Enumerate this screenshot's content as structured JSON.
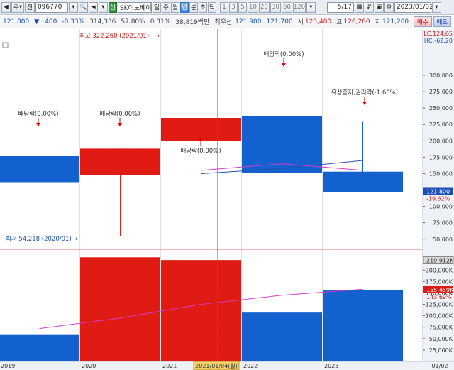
{
  "toolbar": {
    "mode": "주",
    "search_label": "전",
    "code": "096770",
    "name": "SK이노베이",
    "period_buttons": [
      "일",
      "주",
      "월",
      "년",
      "분",
      "초",
      "틱"
    ],
    "selected_period": "년",
    "interval_buttons": [
      "1",
      "3",
      "5",
      "10",
      "20",
      "30",
      "60",
      "120"
    ],
    "page": "5/17",
    "date": "2023/01/02"
  },
  "quote": {
    "price": "121,800",
    "change": "400",
    "change_pct": "-0.33%",
    "volume": "314,336",
    "volume_ratio": "57.80%",
    "turnover_ratio": "0.31%",
    "amount": "38,819백만",
    "best_label": "최우선",
    "ask": "121,900",
    "bid": "121,700",
    "open_label": "시",
    "open": "123,400",
    "high_label": "고",
    "high": "126,200",
    "low_label": "저",
    "low": "121,200",
    "buy_button": "매수",
    "sell_button": "매도"
  },
  "colors": {
    "up": "#e01b14",
    "down": "#1360cf",
    "ma": "#d23cc8"
  },
  "chart_data": {
    "type": "candlestick",
    "categories": [
      "2019",
      "2020",
      "2021",
      "2022",
      "2023"
    ],
    "candles": [
      {
        "open": 137000,
        "high": 177000,
        "low": 139000,
        "close": 177000,
        "down": true
      },
      {
        "open": 148000,
        "high": 188000,
        "low": 54218,
        "close": 188000,
        "down": false
      },
      {
        "open": 200000,
        "high": 322260,
        "low": 139000,
        "close": 235000,
        "down": false
      },
      {
        "open": 238000,
        "high": 275000,
        "low": 139000,
        "close": 151000,
        "down": true
      },
      {
        "open": 153000,
        "high": 229000,
        "low": 121200,
        "close": 121800,
        "down": true
      }
    ],
    "ma_upper": [
      null,
      null,
      150000,
      158000,
      170000
    ],
    "ma_lower": [
      null,
      null,
      155000,
      165000,
      155000
    ],
    "price_ylim": [
      40000,
      300000
    ],
    "price_ticks": [
      "300,000",
      "275,000",
      "250,000",
      "225,000",
      "200,000",
      "175,000",
      "150,000",
      "125,000",
      "100,000",
      "75,000",
      "50,000"
    ],
    "price_ticks_values": [
      300000,
      275000,
      250000,
      225000,
      200000,
      175000,
      150000,
      125000,
      100000,
      75000,
      50000
    ],
    "price_label": "121,800",
    "price_label_pct": "-19.62%",
    "lc_label": "LC:124.65",
    "hc_label": "HC:-62.20",
    "annotations": {
      "high": "최고 322,260 (2021/01)",
      "low": "최저 54,218 (2020/01)",
      "dividends": [
        "배당락(0.00%)",
        "배당락(0.00%)",
        "배당락(0.00%)",
        "배당락(0.00%)"
      ],
      "rights": "유상증자,권리락(-1.60%)"
    },
    "volume": {
      "values": [
        58000,
        228000,
        222000,
        107000,
        155459
      ],
      "ylim": [
        0,
        230000
      ],
      "ticks": [
        "200,000K",
        "175,000K",
        "150,000K",
        "125,000K",
        "100,000K",
        "75,000K",
        "50,000K",
        "25,000K"
      ],
      "tick_values": [
        200000,
        175000,
        150000,
        125000,
        100000,
        75000,
        50000,
        25000
      ],
      "ma": [
        72000,
        95000,
        125000,
        145000,
        158000
      ],
      "max_label": "219,912K",
      "current_label": "155,459K",
      "current_pct": "143.69%"
    },
    "x_labels": [
      "2019",
      "2020",
      "2021",
      "2022",
      "2023"
    ],
    "cursor_label": "2021/01/04(월)",
    "right_date": "01/02"
  }
}
